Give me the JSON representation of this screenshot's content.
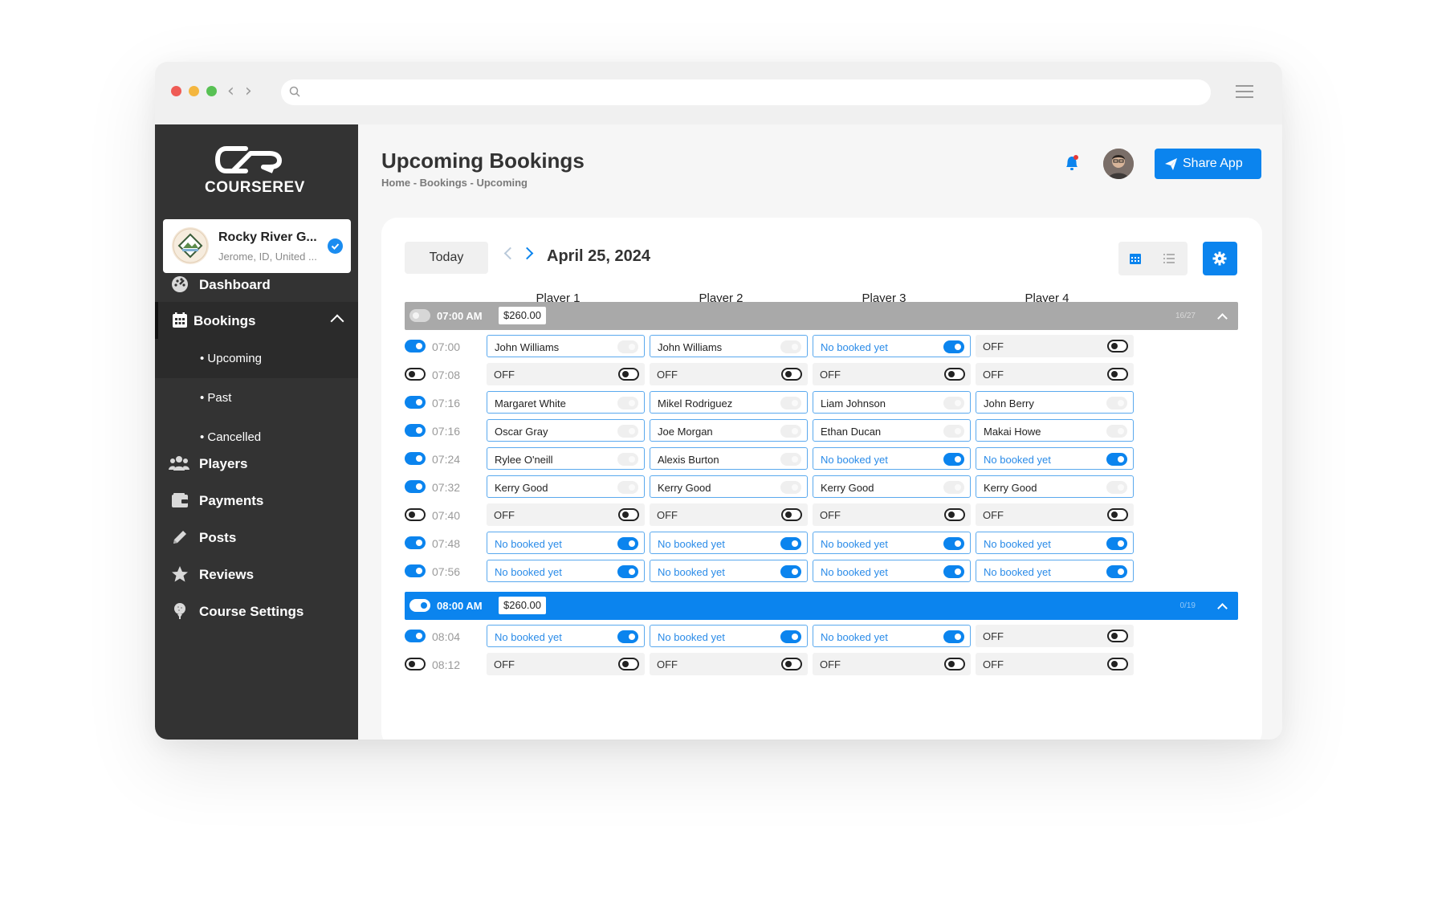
{
  "brand": {
    "name": "COURSEREV"
  },
  "course": {
    "name": "Rocky River G...",
    "location": "Jerome, ID, United ..."
  },
  "nav": {
    "dashboard": "Dashboard",
    "bookings": "Bookings",
    "upcoming": "• Upcoming",
    "past": "• Past",
    "cancelled": "• Cancelled",
    "players": "Players",
    "payments": "Payments",
    "posts": "Posts",
    "reviews": "Reviews",
    "course_settings": "Course Settings"
  },
  "header": {
    "title": "Upcoming Bookings",
    "breadcrumb": "Home - Bookings - Upcoming",
    "share_label": "Share App"
  },
  "toolbar": {
    "today": "Today",
    "date": "April 25, 2024"
  },
  "columns": [
    "Player 1",
    "Player 2",
    "Player 3",
    "Player 4"
  ],
  "groups": [
    {
      "time": "07:00 AM",
      "price": "$260.00",
      "count": "16/27",
      "state": "gray",
      "rows": [
        {
          "time": "07:00",
          "on": true,
          "slots": [
            {
              "text": "John Williams",
              "kind": "name"
            },
            {
              "text": "John Williams",
              "kind": "name"
            },
            {
              "text": "No booked yet",
              "kind": "empty"
            },
            {
              "text": "OFF",
              "kind": "off"
            }
          ]
        },
        {
          "time": "07:08",
          "on": false,
          "slots": [
            {
              "text": "OFF",
              "kind": "off"
            },
            {
              "text": "OFF",
              "kind": "off"
            },
            {
              "text": "OFF",
              "kind": "off"
            },
            {
              "text": "OFF",
              "kind": "off"
            }
          ]
        },
        {
          "time": "07:16",
          "on": true,
          "slots": [
            {
              "text": "Margaret White",
              "kind": "name"
            },
            {
              "text": "Mikel Rodriguez",
              "kind": "name"
            },
            {
              "text": "Liam Johnson",
              "kind": "name"
            },
            {
              "text": "John Berry",
              "kind": "name"
            }
          ]
        },
        {
          "time": "07:16",
          "on": true,
          "slots": [
            {
              "text": "Oscar Gray",
              "kind": "name"
            },
            {
              "text": "Joe Morgan",
              "kind": "name"
            },
            {
              "text": "Ethan Ducan",
              "kind": "name"
            },
            {
              "text": "Makai Howe",
              "kind": "name"
            }
          ]
        },
        {
          "time": "07:24",
          "on": true,
          "slots": [
            {
              "text": "Rylee O'neill",
              "kind": "name"
            },
            {
              "text": "Alexis Burton",
              "kind": "name"
            },
            {
              "text": "No booked yet",
              "kind": "empty"
            },
            {
              "text": "No booked yet",
              "kind": "empty"
            }
          ]
        },
        {
          "time": "07:32",
          "on": true,
          "slots": [
            {
              "text": "Kerry Good",
              "kind": "name"
            },
            {
              "text": "Kerry Good",
              "kind": "name"
            },
            {
              "text": "Kerry Good",
              "kind": "name"
            },
            {
              "text": "Kerry Good",
              "kind": "name"
            }
          ]
        },
        {
          "time": "07:40",
          "on": false,
          "slots": [
            {
              "text": "OFF",
              "kind": "off"
            },
            {
              "text": "OFF",
              "kind": "off"
            },
            {
              "text": "OFF",
              "kind": "off"
            },
            {
              "text": "OFF",
              "kind": "off"
            }
          ]
        },
        {
          "time": "07:48",
          "on": true,
          "slots": [
            {
              "text": "No booked yet",
              "kind": "empty"
            },
            {
              "text": "No booked yet",
              "kind": "empty"
            },
            {
              "text": "No booked yet",
              "kind": "empty"
            },
            {
              "text": "No booked yet",
              "kind": "empty"
            }
          ]
        },
        {
          "time": "07:56",
          "on": true,
          "slots": [
            {
              "text": "No booked yet",
              "kind": "empty"
            },
            {
              "text": "No booked yet",
              "kind": "empty"
            },
            {
              "text": "No booked yet",
              "kind": "empty"
            },
            {
              "text": "No booked yet",
              "kind": "empty"
            }
          ]
        }
      ]
    },
    {
      "time": "08:00 AM",
      "price": "$260.00",
      "count": "0/19",
      "state": "blue",
      "rows": [
        {
          "time": "08:04",
          "on": true,
          "slots": [
            {
              "text": "No booked yet",
              "kind": "empty"
            },
            {
              "text": "No booked yet",
              "kind": "empty"
            },
            {
              "text": "No booked yet",
              "kind": "empty"
            },
            {
              "text": "OFF",
              "kind": "off"
            }
          ]
        },
        {
          "time": "08:12",
          "on": false,
          "slots": [
            {
              "text": "OFF",
              "kind": "off"
            },
            {
              "text": "OFF",
              "kind": "off"
            },
            {
              "text": "OFF",
              "kind": "off"
            },
            {
              "text": "OFF",
              "kind": "off"
            }
          ]
        }
      ]
    }
  ],
  "colors": {
    "accent": "#0b84ee",
    "sidebar": "#333333",
    "group_inactive": "#a9a9a9"
  }
}
